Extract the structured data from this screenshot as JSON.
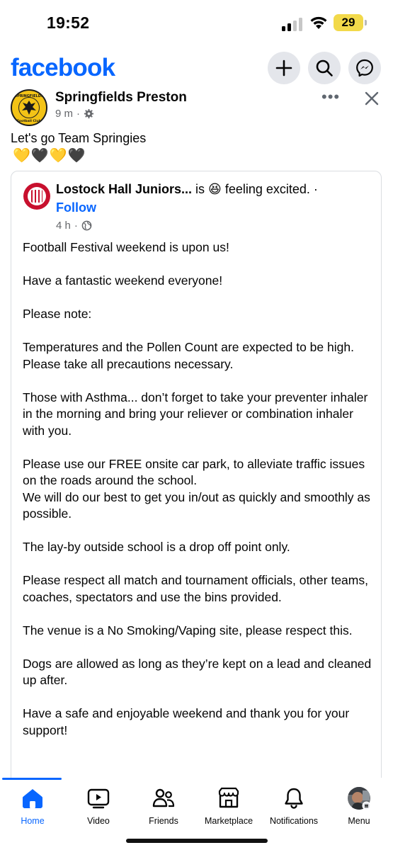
{
  "status_bar": {
    "time": "19:52",
    "battery": "29"
  },
  "header": {
    "logo": "facebook",
    "icons": [
      "plus-icon",
      "search-icon",
      "messenger-icon"
    ]
  },
  "post": {
    "author": "Springfields Preston",
    "time": "9 m",
    "audience_icon": "gear-icon",
    "caption": "Let's go Team Springies",
    "emoji": "💛🖤💛🖤",
    "avatar_text": {
      "top": "SPRINGFIELDS",
      "bottom": "Football Club"
    }
  },
  "shared": {
    "page_name": "Lostock Hall Juniors...",
    "status": " is 😆 feeling excited. ·",
    "follow": "Follow",
    "time": "4 h",
    "audience_icon": "globe-icon",
    "paragraphs": [
      "Football Festival weekend is upon us!",
      "Have a fantastic weekend everyone!",
      "Please note:",
      "Temperatures and the Pollen Count are expected to be high. Please take all precautions necessary.",
      "Those with Asthma... don’t forget to take your preventer inhaler in the morning and bring your reliever or combination inhaler with you.",
      "Please use our FREE onsite car park, to alleviate traffic issues on the roads around the school.",
      "We will do our best to get you in/out as quickly and smoothly as possible.",
      "The lay-by outside school is a drop off point only.",
      "Please respect all match and tournament officials, other teams, coaches, spectators and use the bins provided.",
      "The venue is a No Smoking/Vaping site, please respect this.",
      "Dogs are allowed as long as they’re kept on a lead and cleaned up after.",
      "Have a safe and enjoyable weekend and thank you for your support!"
    ]
  },
  "tabs": [
    {
      "label": "Home",
      "icon": "home-icon",
      "active": true
    },
    {
      "label": "Video",
      "icon": "video-icon",
      "active": false
    },
    {
      "label": "Friends",
      "icon": "friends-icon",
      "active": false
    },
    {
      "label": "Marketplace",
      "icon": "marketplace-icon",
      "active": false
    },
    {
      "label": "Notifications",
      "icon": "bell-icon",
      "active": false
    },
    {
      "label": "Menu",
      "icon": "avatar",
      "active": false
    }
  ],
  "colors": {
    "brand": "#0866ff",
    "meta": "#65676b",
    "battery": "#f2d94a"
  }
}
